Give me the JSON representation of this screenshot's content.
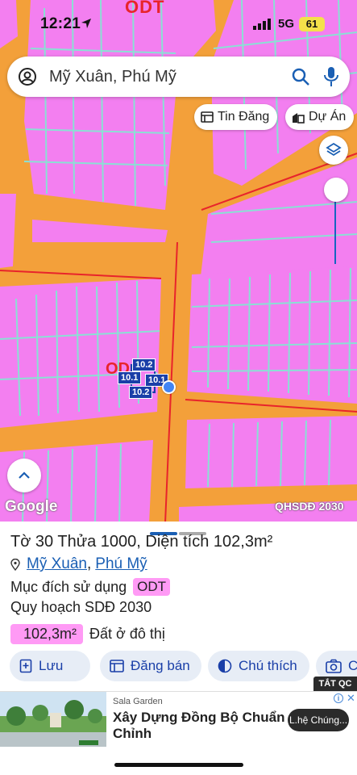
{
  "status_bar": {
    "time": "12:21",
    "network": "5G",
    "battery": "61"
  },
  "map": {
    "top_zone_label": "ODT",
    "zone_label": "OD",
    "parcel_labels": [
      "10.2",
      "10.1",
      "10.1",
      "10.2"
    ],
    "attribution": "Google",
    "map_source": "QHSDĐ 2030",
    "colors": {
      "residential": "#f37ff0",
      "road": "#f3a03a",
      "parcel_line": "#8ae0d4",
      "boundary": "#e8242b"
    }
  },
  "search": {
    "value": "Mỹ Xuân, Phú Mỹ"
  },
  "chips": {
    "tin_dang": "Tin Đăng",
    "du_an": "Dự Án"
  },
  "parcel": {
    "title_prefix": "Tờ",
    "sheet": "30",
    "plot_word": "Thửa",
    "plot": "1000",
    "area_label": "Diện tích",
    "area": "102,3m²",
    "ward": "Mỹ Xuân",
    "district": "Phú Mỹ",
    "purpose_label": "Mục đích sử dụng",
    "purpose_code": "ODT",
    "plan_label": "Quy hoạch SDĐ 2030",
    "plan_area": "102,3m²",
    "plan_use": "Đất ở đô thị"
  },
  "actions": {
    "save": "Lưu",
    "post_sale": "Đăng bán",
    "legend": "Chú thích",
    "camera": "C"
  },
  "ad": {
    "tag": "TẮT QC",
    "brand": "Sala Garden",
    "title": "Xây Dựng Đồng Bộ Chuẩn Chỉnh",
    "cta": "L.hệ Chúng..."
  }
}
